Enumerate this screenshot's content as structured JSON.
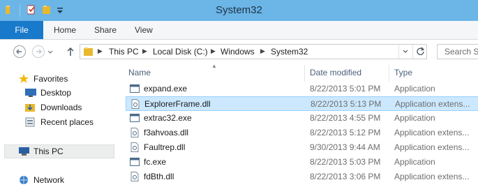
{
  "window": {
    "title": "System32",
    "accent": "#1979ca",
    "titlebar_color": "#6bb5e7"
  },
  "quick_access": {
    "icons": [
      "folder-icon",
      "properties-icon",
      "new-folder-icon",
      "customize-dropdown-icon"
    ]
  },
  "ribbon": {
    "tabs": [
      {
        "label": "File",
        "selected": true
      },
      {
        "label": "Home"
      },
      {
        "label": "Share"
      },
      {
        "label": "View"
      }
    ]
  },
  "address": {
    "crumbs": [
      "This PC",
      "Local Disk (C:)",
      "Windows",
      "System32"
    ],
    "search_placeholder": "Search Sy"
  },
  "nav": {
    "items": [
      {
        "label": "Favorites",
        "icon": "star-icon"
      },
      {
        "label": "Desktop",
        "icon": "desktop-icon"
      },
      {
        "label": "Downloads",
        "icon": "downloads-icon"
      },
      {
        "label": "Recent places",
        "icon": "recent-places-icon"
      },
      {
        "label": "This PC",
        "icon": "computer-icon",
        "selected": true
      },
      {
        "label": "Network",
        "icon": "network-icon"
      }
    ]
  },
  "list": {
    "columns": [
      "Name",
      "Date modified",
      "Type"
    ],
    "rows": [
      {
        "name": "expand.exe",
        "date": "8/22/2013 5:01 PM",
        "type": "Application",
        "icon": "exe-icon"
      },
      {
        "name": "ExplorerFrame.dll",
        "date": "8/22/2013 5:13 PM",
        "type": "Application extens...",
        "icon": "dll-icon",
        "selected": true
      },
      {
        "name": "extrac32.exe",
        "date": "8/22/2013 4:55 PM",
        "type": "Application",
        "icon": "exe-icon"
      },
      {
        "name": "f3ahvoas.dll",
        "date": "8/22/2013 5:12 PM",
        "type": "Application extens...",
        "icon": "dll-icon"
      },
      {
        "name": "Faultrep.dll",
        "date": "9/30/2013 9:44 AM",
        "type": "Application extens...",
        "icon": "dll-icon"
      },
      {
        "name": "fc.exe",
        "date": "8/22/2013 5:03 PM",
        "type": "Application",
        "icon": "exe-icon"
      },
      {
        "name": "fdBth.dll",
        "date": "8/22/2013 3:06 PM",
        "type": "Application extens...",
        "icon": "dll-icon"
      }
    ]
  }
}
